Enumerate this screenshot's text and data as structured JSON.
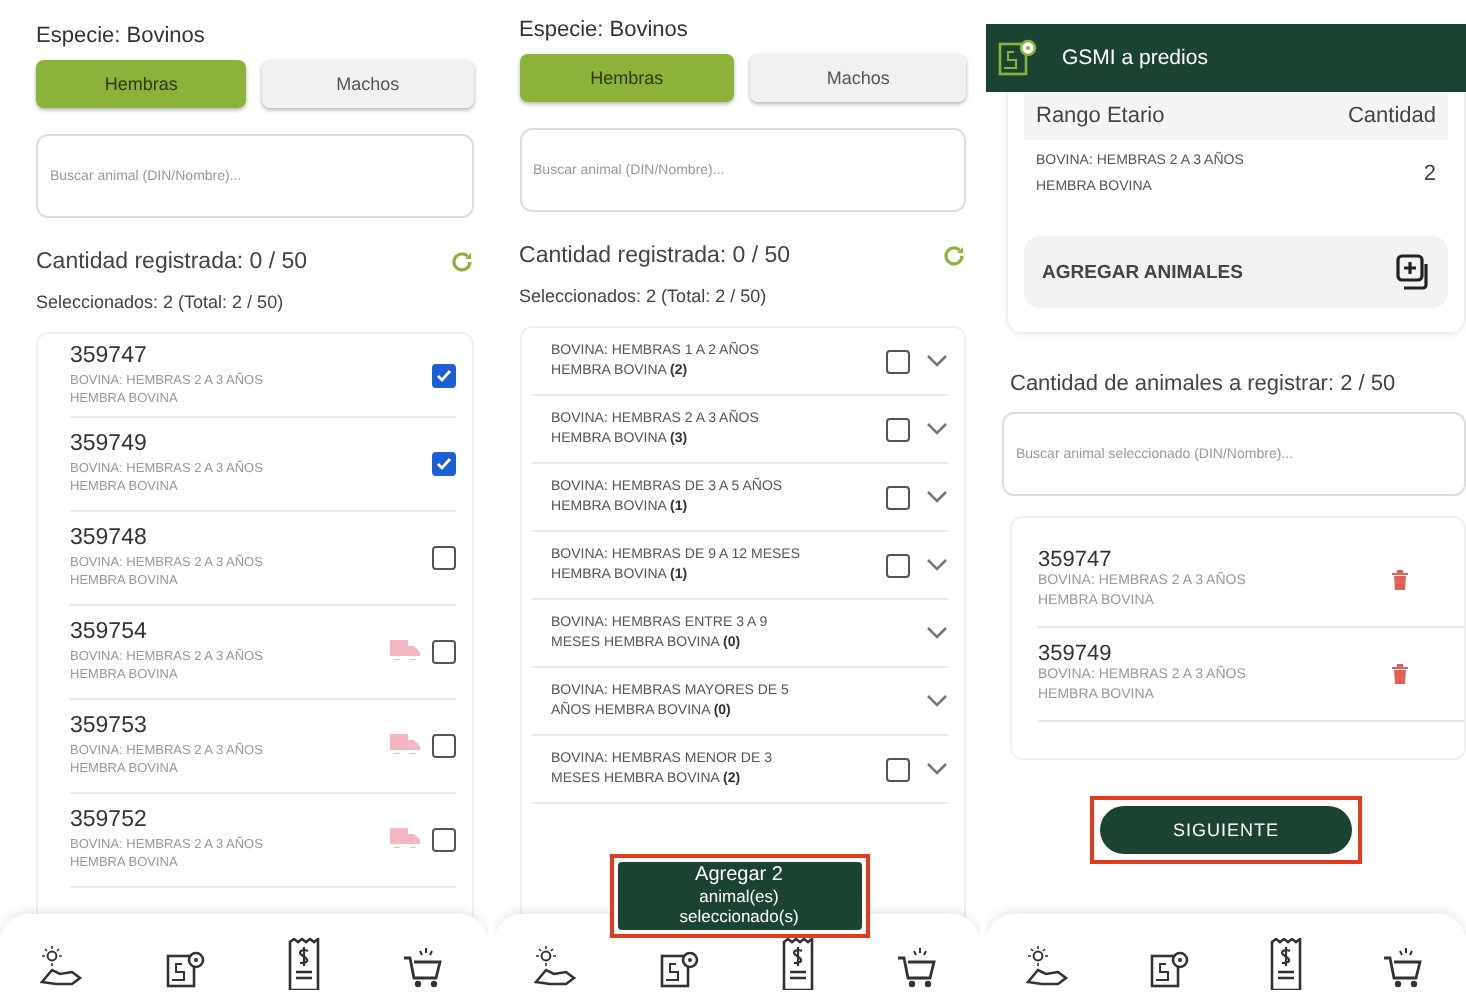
{
  "screen_animals": {
    "species": "Especie: Bovinos",
    "tabs": [
      {
        "label": "Hembras",
        "selected": true
      },
      {
        "label": "Machos",
        "selected": false
      }
    ],
    "search": {
      "placeholder": "Buscar animal (DIN/Nombre)..."
    },
    "registered": "Cantidad registrada: 0 / 50",
    "selected_summary": "Seleccionados: 2 (Total: 2 / 50)",
    "animals": [
      {
        "id": "359747",
        "category": "BOVINA: HEMBRAS 2 A 3 AÑOS HEMBRA BOVINA",
        "truck": false,
        "checked": true
      },
      {
        "id": "359749",
        "category": "BOVINA: HEMBRAS 2 A 3 AÑOS HEMBRA BOVINA",
        "truck": false,
        "checked": true
      },
      {
        "id": "359748",
        "category": "BOVINA: HEMBRAS 2 A 3 AÑOS HEMBRA BOVINA",
        "truck": false,
        "checked": false
      },
      {
        "id": "359754",
        "category": "BOVINA: HEMBRAS 2 A 3 AÑOS HEMBRA BOVINA",
        "truck": true,
        "checked": false
      },
      {
        "id": "359753",
        "category": "BOVINA: HEMBRAS 2 A 3 AÑOS HEMBRA BOVINA",
        "truck": true,
        "checked": false
      },
      {
        "id": "359752",
        "category": "BOVINA: HEMBRAS 2 A 3 AÑOS HEMBRA BOVINA",
        "truck": true,
        "checked": false
      }
    ]
  },
  "screen_groups": {
    "species": "Especie: Bovinos",
    "tabs": [
      {
        "label": "Hembras",
        "selected": true
      },
      {
        "label": "Machos",
        "selected": false
      }
    ],
    "search": {
      "placeholder": "Buscar animal (DIN/Nombre)..."
    },
    "registered": "Cantidad registrada: 0 / 50",
    "selected_summary": "Seleccionados: 2 (Total: 2 / 50)",
    "groups": [
      {
        "label": "BOVINA: HEMBRAS 1 A 2 AÑOS HEMBRA BOVINA **(2)**",
        "kind": "checkable",
        "checked": false,
        "expanded": false
      },
      {
        "label": "BOVINA: HEMBRAS 2 A 3 AÑOS HEMBRA BOVINA **(3)**",
        "kind": "checkable",
        "checked": false,
        "expanded": false
      },
      {
        "label": "BOVINA: HEMBRAS DE 3 A 5 AÑOS HEMBRA BOVINA **(1)**",
        "kind": "checkable",
        "checked": false,
        "expanded": false
      },
      {
        "label": "BOVINA: HEMBRAS DE 9 A 12 MESES HEMBRA BOVINA **(1)**",
        "kind": "checkable",
        "checked": false,
        "expanded": false
      },
      {
        "label": "BOVINA: HEMBRAS ENTRE 3 A 9 MESES HEMBRA BOVINA **(0)**",
        "kind": "empty",
        "expanded": false
      },
      {
        "label": "BOVINA: HEMBRAS MAYORES DE 5 AÑOS HEMBRA BOVINA **(0)**",
        "kind": "empty",
        "expanded": false
      },
      {
        "label": "BOVINA: HEMBRAS MENOR DE 3 MESES HEMBRA BOVINA **(2)**",
        "kind": "checkable",
        "checked": false,
        "expanded": false
      }
    ],
    "add_button": {
      "lines": [
        "Agregar 2",
        "animal(es)",
        "seleccionado(s)"
      ],
      "highlighted": true
    }
  },
  "screen_summary": {
    "title": "GSMI a predios",
    "table": {
      "columns": [
        "Rango Etario",
        "Cantidad"
      ],
      "rows": [
        [
          "BOVINA: HEMBRAS 2 A 3 AÑOS HEMBRA BOVINA",
          "2"
        ]
      ]
    },
    "add_animals": "AGREGAR ANIMALES",
    "to_register": "Cantidad de animales a registrar: 2 / 50",
    "search": {
      "placeholder": "Buscar animal seleccionado (DIN/Nombre)..."
    },
    "animals": [
      {
        "id": "359747",
        "category": "BOVINA: HEMBRAS 2 A 3 AÑOS HEMBRA BOVINA"
      },
      {
        "id": "359749",
        "category": "BOVINA: HEMBRAS 2 A 3 AÑOS HEMBRA BOVINA"
      }
    ],
    "next_button": {
      "label": "SIGUIENTE",
      "highlighted": true
    }
  }
}
